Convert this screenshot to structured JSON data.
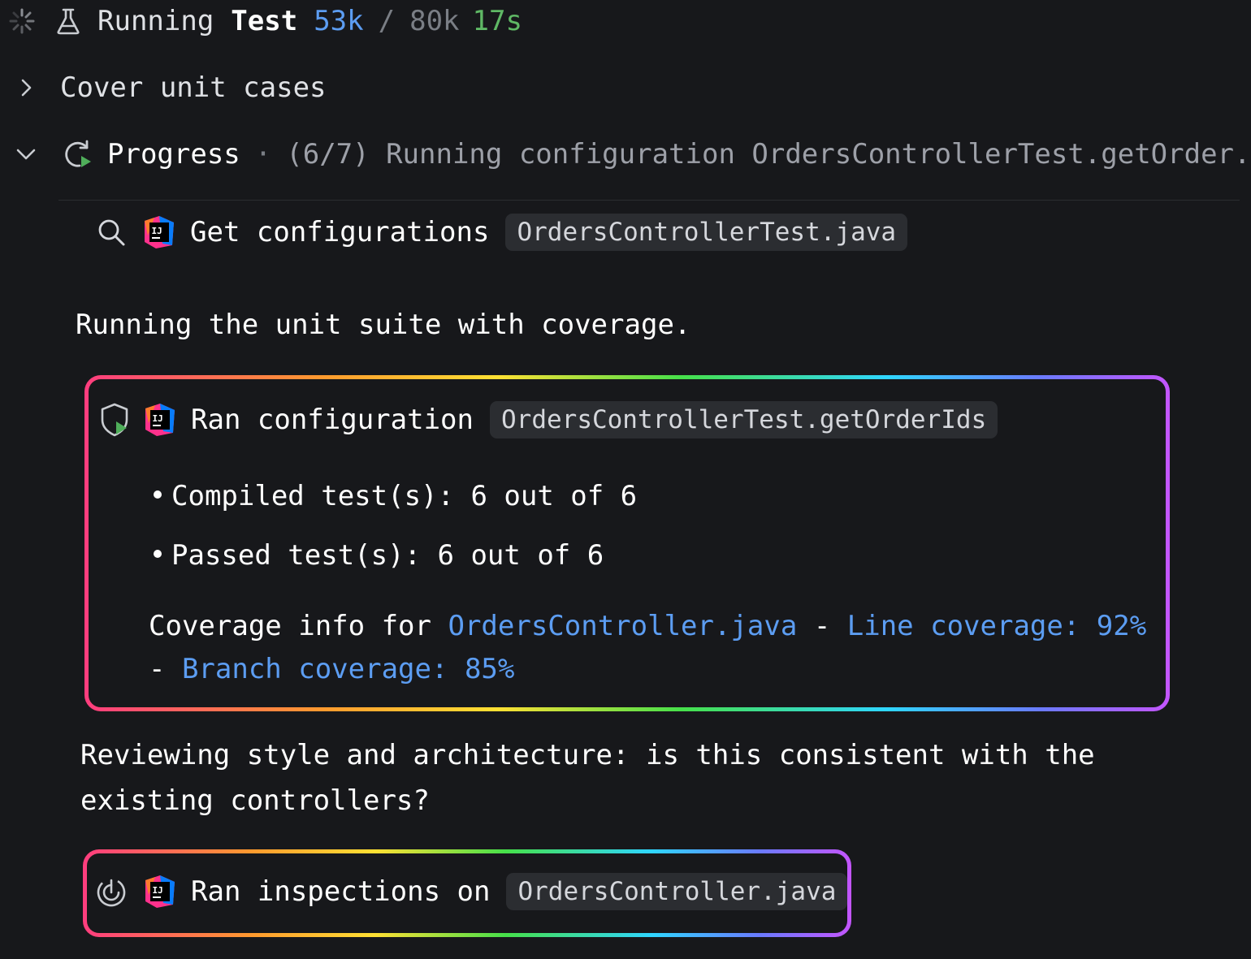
{
  "header": {
    "title_a": "Running",
    "title_b": "Test",
    "tokens_used": "53k",
    "separator": "/",
    "tokens_max": "80k",
    "elapsed": "17s"
  },
  "cover_row": {
    "label": "Cover unit cases"
  },
  "progress": {
    "label": "Progress",
    "separator": "·",
    "detail": "(6/7) Running configuration OrdersControllerTest.getOrder."
  },
  "get_configurations": {
    "label": "Get configurations",
    "file": "OrdersControllerTest.java"
  },
  "paragraph_1": "Running the unit suite with coverage.",
  "ran_configuration": {
    "label": "Ran configuration",
    "target": "OrdersControllerTest.getOrderIds",
    "bullets": [
      "Compiled test(s): 6 out of 6",
      "Passed test(s): 6 out of 6"
    ],
    "coverage": {
      "prefix": "Coverage info for ",
      "file": "OrdersController.java",
      "dash1": " - ",
      "line_cov": "Line coverage: 92%",
      "dash2": "- ",
      "branch_cov": "Branch coverage: 85%"
    }
  },
  "paragraph_2": {
    "line_1": "Reviewing style and architecture: is this consistent with the",
    "line_2": "existing controllers?"
  },
  "ran_inspections": {
    "label": "Ran inspections on",
    "file": "OrdersController.java"
  },
  "colors": {
    "background": "#17181b",
    "accent_blue": "#5c9df2",
    "accent_green": "#5fb865",
    "muted": "#7a7e85"
  },
  "icons": [
    "spinner-icon",
    "flask-icon",
    "chevron-right-icon",
    "chevron-down-icon",
    "rerun-icon",
    "search-icon",
    "intellij-logo-icon",
    "shield-run-icon",
    "gauge-icon"
  ]
}
